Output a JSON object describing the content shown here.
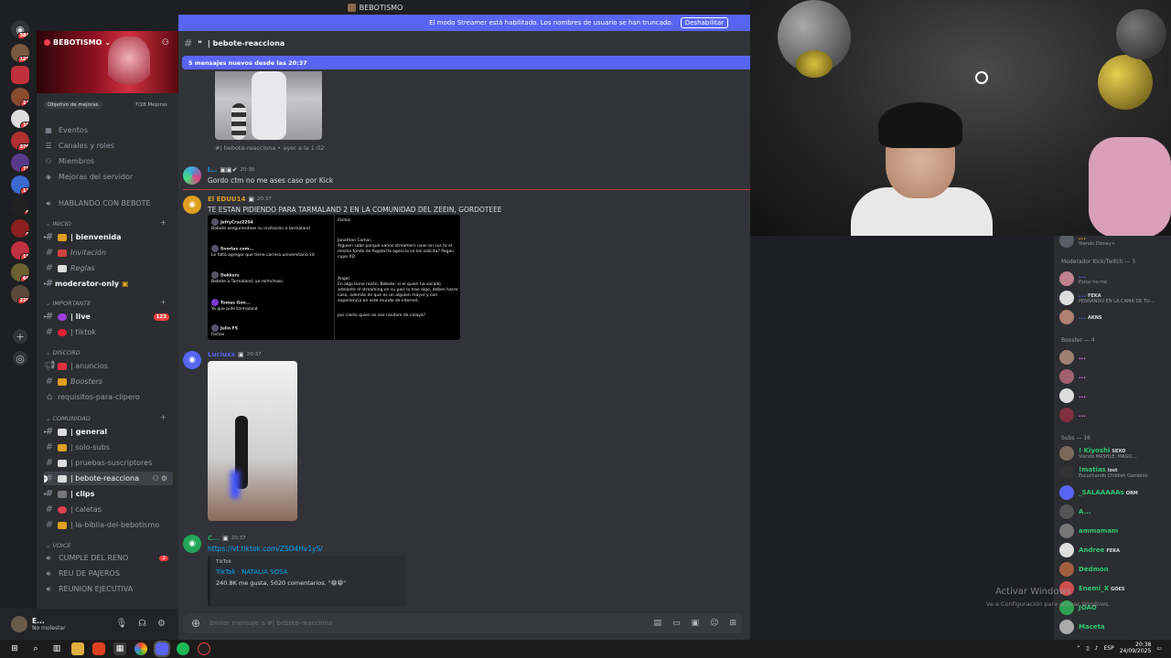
{
  "titlebar": {
    "title": "BEBOTISMO"
  },
  "server_rail": {
    "home_icon": "discord-icon",
    "servers": [
      {
        "badge": "384"
      },
      {
        "badge": "125"
      },
      {
        "badge": ""
      },
      {
        "badge": "21"
      },
      {
        "badge": "16"
      },
      {
        "badge": "376"
      },
      {
        "badge": "75"
      },
      {
        "badge": "13"
      },
      {
        "badge": "9"
      },
      {
        "badge": "5"
      },
      {
        "badge": "15"
      },
      {
        "badge": "68"
      },
      {
        "badge": "229"
      }
    ]
  },
  "sidebar": {
    "server_name": "BEBOTISMO",
    "boost_label": "Objetivo de mejoras",
    "boost_progress": "7/28 Mejoras",
    "top_items": [
      "Eventos",
      "Canales y roles",
      "Miembros",
      "Mejoras del servidor"
    ],
    "voice_top": "HABLANDO CON BEBOTE",
    "categories": {
      "inicio": "INICIO",
      "importante": "IMPORTANTE",
      "discord": "DISCORD",
      "comunidad": "COMUNIDAD",
      "voice": "VOICE"
    },
    "channels": {
      "bienvenida": "| bienvenida",
      "invitacion": "Invitación",
      "reglas": "Reglas",
      "moderator": "moderator-only",
      "live": "| live",
      "live_count": "123",
      "tiktok": "| tiktok",
      "anuncios": "| anuncios",
      "boosters": "Boosters",
      "requisitos": "requisitos-para-clipero",
      "general": "| general",
      "solo_subs": "| solo-subs",
      "pruebas": "| pruebas-suscriptores",
      "bebote": "| bebote-reacciona",
      "clips": "| clips",
      "caletas": "| caletas",
      "biblia": "| la-biblia-del-bebotismo"
    },
    "voice_channels": [
      "CUMPLE DEL RENO",
      "REU DE PAJEROS",
      "REUNION EJECUTIVA"
    ],
    "voice_badge": "2"
  },
  "user_panel": {
    "name": "E...",
    "status": "No molestar"
  },
  "main": {
    "streamer_notice": "El modo Streamer está habilitado. Los nombres de usuario se han truncado.",
    "streamer_button": "Deshabilitar",
    "channel_name": "| bebote-reacciona",
    "new_messages": "5 mensajes nuevos desde las 20:37",
    "reply_ref": "#| bebote-reacciona • ayer a la 1:02",
    "messages": [
      {
        "name": "l...",
        "time": "20:36",
        "text": "Gordo ctm no me ases caso por Kick"
      },
      {
        "name": "El EDUU14",
        "time": "20:37",
        "text": "TE ESTAN PIDIENDO PARA TARMALAND 2 EN LA COMUNIDAD DEL ZEEIN, GORDOTEEE"
      },
      {
        "name": "Luciuxx",
        "time": "20:37",
        "text": ""
      },
      {
        "name": "C...",
        "time": "20:37",
        "text": "https://vt.tiktok.com/ZSD4Hv1yS/"
      }
    ],
    "tweets_left": [
      {
        "user": "JefryCruz2204",
        "text": "Bebote asegurandose su invitación a tarmaland"
      },
      {
        "user": "Snorlax com...",
        "text": "Le faltó agregar que tiene carrera universitaria xd"
      },
      {
        "user": "Dekkers",
        "text": "Bebote a Tarmaland, ya reímchoso"
      },
      {
        "user": "Tomas Gon...",
        "text": "Ya que pide tarmaland"
      },
      {
        "user": "Julio FS",
        "text": "Factos"
      }
    ],
    "tweets_right": [
      {
        "user": "",
        "text": "Factos"
      },
      {
        "user": "Jonathan Camar...",
        "text": "Alguien sabe porque varios streamers usan en sus tv el mismo fondo de fogata?la agencia se los solicita? Pagan cupo XD"
      },
      {
        "user": "Angel",
        "text": "En algo tiene razón, Bebote: si el quien ha sacado adelante el streaming en su país lo trae algo, deben hacer caso, además de que es un alguien mayor y con experiencia en este mundo de internet."
      },
      {
        "user": "",
        "text": "por cierto quien es ese random de celaya?"
      }
    ],
    "embed": {
      "provider": "TikTok",
      "title": "TikTok · NATALIA SOSA",
      "desc": "240.8K me gusta, 5020 comentarios. \"😁😁\""
    },
    "composer_placeholder": "Enviar mensaje a #| bebote-reacciona"
  },
  "members": {
    "top_name": "...",
    "top_sub": "Viendo Disney+",
    "groups": [
      {
        "label": "Moderador Kick/Twitch — 3"
      },
      {
        "label": "Booster — 4"
      },
      {
        "label": "Subs — 16"
      }
    ],
    "mods": [
      {
        "name": "...",
        "sub": "Estoy no me",
        "tag": ""
      },
      {
        "name": "...",
        "sub": "PENSANDO EN LA CAMA DE TU...",
        "tag": "FEKA"
      },
      {
        "name": "...",
        "sub": "",
        "tag": "AKNS"
      }
    ],
    "subs": [
      {
        "name": "! Kiyoshi",
        "sub": "Viendo MASHLE: MAGIC...",
        "tag": "SEXO",
        "color": "#2dc770"
      },
      {
        "name": "!matias",
        "sub": "Escuchando Childish Gambino",
        "tag": "lost",
        "color": "#2dc770"
      },
      {
        "name": "_SALAAAAAs",
        "sub": "",
        "tag": "ORM",
        "color": "#2dc770"
      },
      {
        "name": "A...",
        "sub": "",
        "tag": "",
        "color": "#2dc770"
      },
      {
        "name": "ammamam",
        "sub": "",
        "tag": "",
        "color": "#2dc770"
      },
      {
        "name": "Andree",
        "sub": "",
        "tag": "FEKA",
        "color": "#2dc770"
      },
      {
        "name": "Dedmon",
        "sub": "",
        "tag": "",
        "color": "#2dc770"
      },
      {
        "name": "Enemi_X",
        "sub": "",
        "tag": "GOES",
        "color": "#2dc770"
      },
      {
        "name": "JOAO",
        "sub": "",
        "tag": "",
        "color": "#2dc770"
      },
      {
        "name": "Maceta",
        "sub": "",
        "tag": "",
        "color": "#2dc770"
      }
    ]
  },
  "overlay": {
    "activate": "Activar Windows",
    "activate_sub": "Ve a Configuración para activar Windows."
  },
  "taskbar": {
    "time": "20:38",
    "date": "24/09/2025",
    "lang": "ESP"
  },
  "colors": {
    "accent": "#5865f2",
    "danger": "#f23f42",
    "sidebar": "#2b2d31",
    "chat": "#313338"
  }
}
